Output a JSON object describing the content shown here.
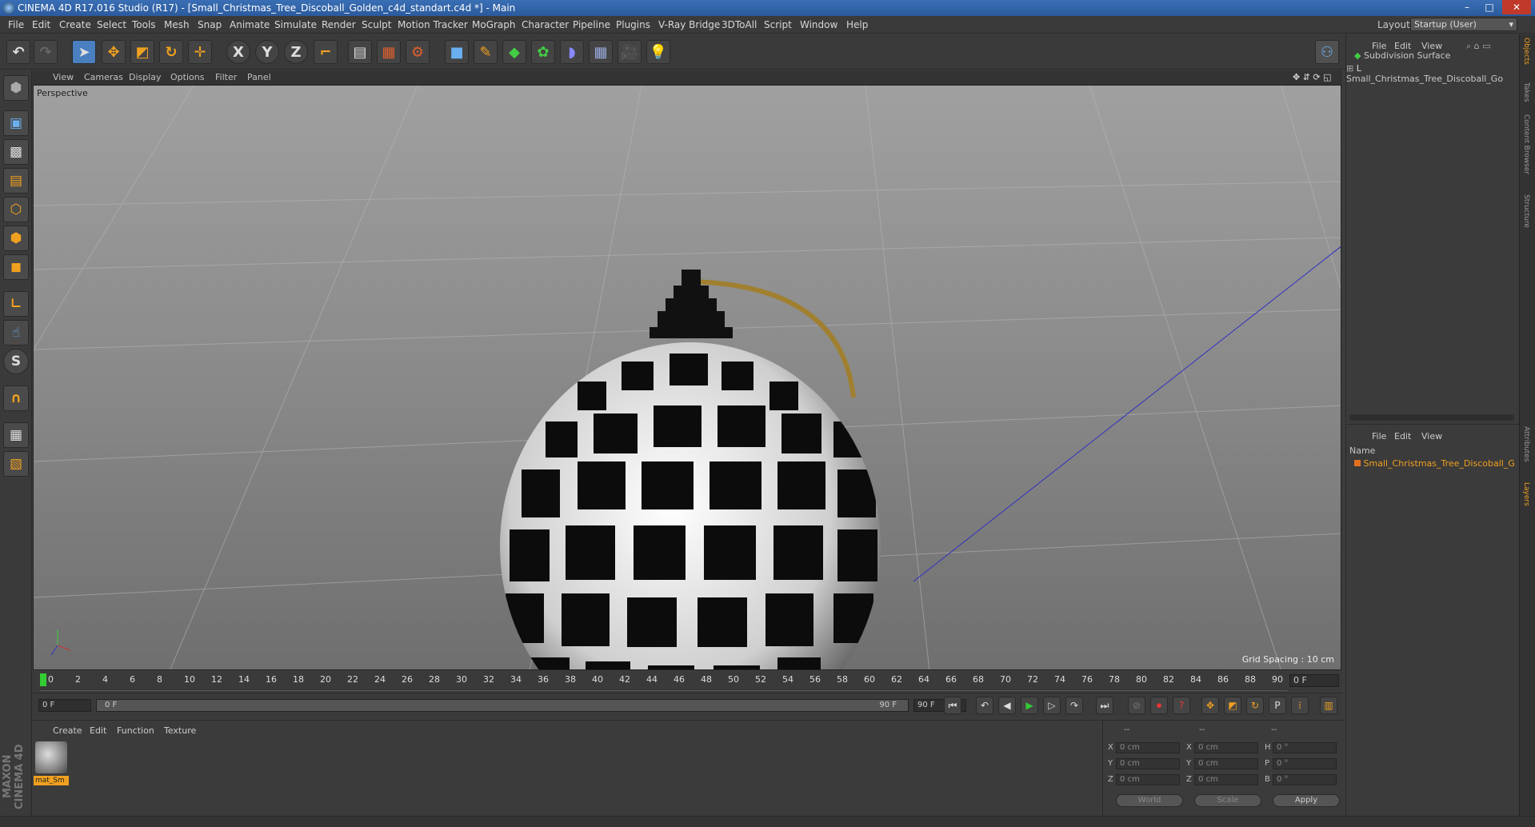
{
  "window": {
    "title": "CINEMA 4D R17.016 Studio (R17) - [Small_Christmas_Tree_Discoball_Golden_c4d_standart.c4d *] - Main"
  },
  "menubar": {
    "items": [
      "File",
      "Edit",
      "Create",
      "Select",
      "Tools",
      "Mesh",
      "Snap",
      "Animate",
      "Simulate",
      "Render",
      "Sculpt",
      "Motion Tracker",
      "MoGraph",
      "Character",
      "Pipeline",
      "Plugins",
      "V-Ray Bridge",
      "3DToAll",
      "Script",
      "Window",
      "Help"
    ],
    "layout_label": "Layout:",
    "layout_value": "Startup (User)"
  },
  "toolbar": {
    "icons": [
      "undo-icon",
      "redo-icon",
      "select-arrow-icon",
      "move-icon",
      "scale-icon",
      "rotate-icon",
      "transform-icon",
      "x-axis-icon",
      "y-axis-icon",
      "z-axis-icon",
      "coordinate-system-icon",
      "render-view-icon",
      "render-region-icon",
      "render-settings-icon",
      "cube-icon",
      "pen-icon",
      "subdivision-icon",
      "array-icon",
      "deformer-icon",
      "floor-icon",
      "camera-icon",
      "light-icon"
    ]
  },
  "viewport": {
    "menu": [
      "View",
      "Cameras",
      "Display",
      "Options",
      "Filter",
      "Panel"
    ],
    "label": "Perspective",
    "grid_spacing": "Grid Spacing : 10 cm"
  },
  "timeline": {
    "ticks": [
      "0",
      "2",
      "4",
      "6",
      "8",
      "10",
      "12",
      "14",
      "16",
      "18",
      "20",
      "22",
      "24",
      "26",
      "28",
      "30",
      "32",
      "34",
      "36",
      "38",
      "40",
      "42",
      "44",
      "46",
      "48",
      "50",
      "52",
      "54",
      "56",
      "58",
      "60",
      "62",
      "64",
      "66",
      "68",
      "70",
      "72",
      "74",
      "76",
      "78",
      "80",
      "82",
      "84",
      "86",
      "88",
      "90"
    ],
    "current_frame": "0 F",
    "start_field": "0 F",
    "slider_start": "0 F",
    "slider_end": "90 F",
    "end_field": "90 F"
  },
  "material_panel": {
    "menu": [
      "Create",
      "Edit",
      "Function",
      "Texture"
    ],
    "material_name": "mat_Sm"
  },
  "coordinates": {
    "header": [
      "--",
      "--",
      "--"
    ],
    "rows": [
      {
        "a": "X",
        "a_val": "0 cm",
        "b": "X",
        "b_val": "0 cm",
        "c": "H",
        "c_val": "0 °"
      },
      {
        "a": "Y",
        "a_val": "0 cm",
        "b": "Y",
        "b_val": "0 cm",
        "c": "P",
        "c_val": "0 °"
      },
      {
        "a": "Z",
        "a_val": "0 cm",
        "b": "Z",
        "b_val": "0 cm",
        "c": "B",
        "c_val": "0 °"
      }
    ],
    "world": "World",
    "scale": "Scale",
    "apply": "Apply"
  },
  "object_manager": {
    "menu": [
      "File",
      "Edit",
      "View"
    ],
    "objects": [
      "Subdivision Surface",
      "Small_Christmas_Tree_Discoball_Go"
    ]
  },
  "layer_manager": {
    "menu": [
      "File",
      "Edit",
      "View"
    ],
    "column": "Name",
    "layer": "Small_Christmas_Tree_Discoball_G"
  },
  "side_tabs": [
    "Objects",
    "Takes",
    "Content Browser",
    "Structure",
    "Attributes",
    "Layers"
  ],
  "branding": "MAXON CINEMA 4D",
  "colors": {
    "accent": "#f0a020",
    "active_blue": "#4a7fc0"
  }
}
